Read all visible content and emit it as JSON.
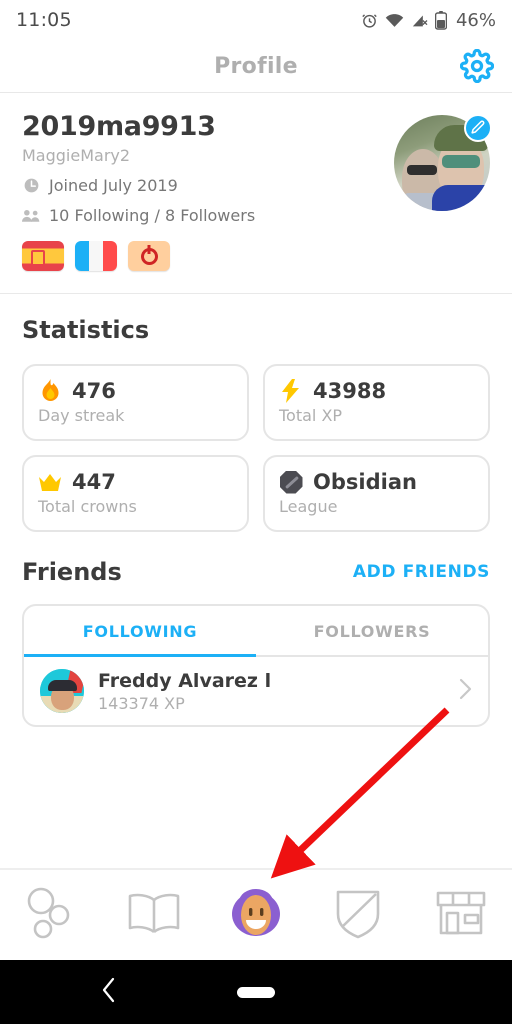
{
  "statusbar": {
    "time": "11:05",
    "battery_percent": "46%",
    "icons": [
      "alarm-icon",
      "wifi-icon",
      "cellular-off-icon",
      "battery-icon"
    ]
  },
  "appbar": {
    "title": "Profile",
    "settings_icon": "gear-icon"
  },
  "profile": {
    "username": "2019ma9913",
    "display_name": "MaggieMary2",
    "joined": "Joined July 2019",
    "joined_icon": "clock-icon",
    "friends_summary": "10 Following / 8 Followers",
    "friends_icon": "people-icon",
    "avatar_name": "profile-photo",
    "edit_icon": "pencil-icon",
    "courses": [
      {
        "name": "spanish-flag",
        "label": "Spanish"
      },
      {
        "name": "french-flag",
        "label": "French"
      },
      {
        "name": "klingon-flag",
        "label": "Klingon"
      }
    ]
  },
  "statistics": {
    "title": "Statistics",
    "cards": [
      {
        "icon": "flame-icon",
        "value": "476",
        "label": "Day streak"
      },
      {
        "icon": "lightning-bolt-icon",
        "value": "43988",
        "label": "Total XP"
      },
      {
        "icon": "crown-icon",
        "value": "447",
        "label": "Total crowns"
      },
      {
        "icon": "obsidian-badge-icon",
        "value": "Obsidian",
        "label": "League"
      }
    ]
  },
  "friends": {
    "title": "Friends",
    "add_friends_label": "ADD FRIENDS",
    "tabs": [
      {
        "label": "FOLLOWING",
        "active": true
      },
      {
        "label": "FOLLOWERS",
        "active": false
      }
    ],
    "list": [
      {
        "name": "Freddy Alvarez l",
        "xp": "143374 XP"
      }
    ]
  },
  "bottom_nav": [
    {
      "name": "nav-learn",
      "icon": "circles-path-icon",
      "active": false
    },
    {
      "name": "nav-stories",
      "icon": "open-book-icon",
      "active": false
    },
    {
      "name": "nav-profile",
      "icon": "avatar-face-icon",
      "active": true
    },
    {
      "name": "nav-leagues",
      "icon": "shield-icon",
      "active": false
    },
    {
      "name": "nav-shop",
      "icon": "store-icon",
      "active": false
    }
  ],
  "android_nav": {
    "back_icon": "chevron-left-icon",
    "home_icon": "home-pill-icon"
  },
  "annotation": {
    "arrow_color": "#ee1111",
    "target": "nav-profile"
  },
  "colors": {
    "accent_blue": "#1cb0f6",
    "text_dark": "#3c3c3c",
    "text_muted": "#afafaf",
    "streak_orange": "#ff9600",
    "xp_yellow": "#ffc800"
  }
}
